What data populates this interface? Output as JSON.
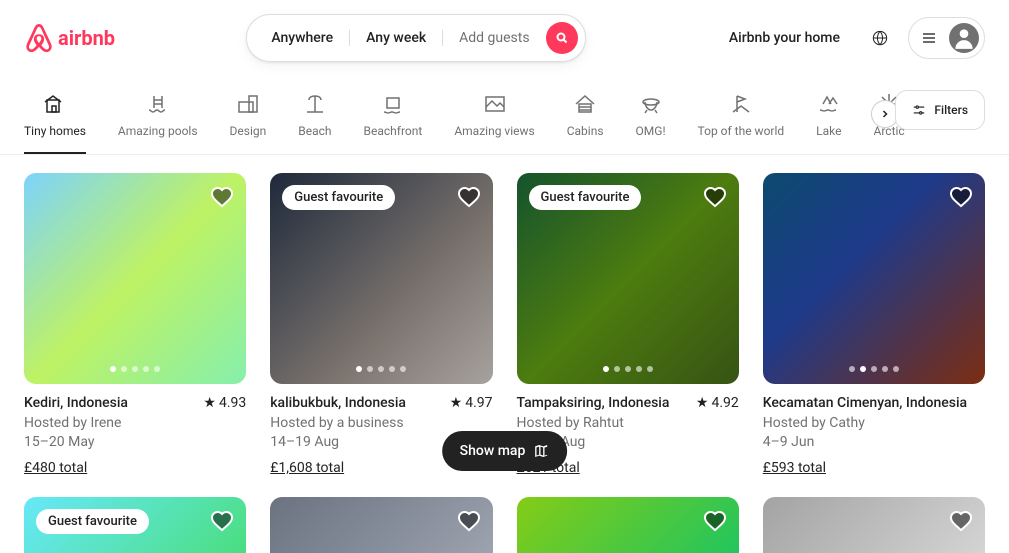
{
  "logo": "airbnb",
  "search": {
    "where": "Anywhere",
    "when": "Any week",
    "who": "Add guests"
  },
  "header": {
    "host": "Airbnb your home"
  },
  "categories": [
    {
      "label": "Tiny homes",
      "active": true
    },
    {
      "label": "Amazing pools"
    },
    {
      "label": "Design"
    },
    {
      "label": "Beach"
    },
    {
      "label": "Beachfront"
    },
    {
      "label": "Amazing views"
    },
    {
      "label": "Cabins"
    },
    {
      "label": "OMG!"
    },
    {
      "label": "Top of the world"
    },
    {
      "label": "Lake"
    },
    {
      "label": "Arctic"
    }
  ],
  "filters_label": "Filters",
  "guest_fav": "Guest favourite",
  "listings": [
    {
      "title": "Kediri, Indonesia",
      "rating": "4.93",
      "host": "Hosted by Irene",
      "dates": "15–20 May",
      "price": "£480 total",
      "badge": false
    },
    {
      "title": "kalibukbuk, Indonesia",
      "rating": "4.97",
      "host": "Hosted by a business",
      "dates": "14–19 Aug",
      "price": "£1,608 total",
      "badge": true
    },
    {
      "title": "Tampaksiring, Indonesia",
      "rating": "4.92",
      "host": "Hosted by Rahtut",
      "dates": "25–30 Aug",
      "price": "£621 total",
      "badge": true
    },
    {
      "title": "Kecamatan Cimenyan, Indonesia",
      "rating": "",
      "host": "Hosted by Cathy",
      "dates": "4–9 Jun",
      "price": "£593 total",
      "badge": false
    }
  ],
  "row2_badge": "Guest favourite",
  "show_map": "Show map"
}
